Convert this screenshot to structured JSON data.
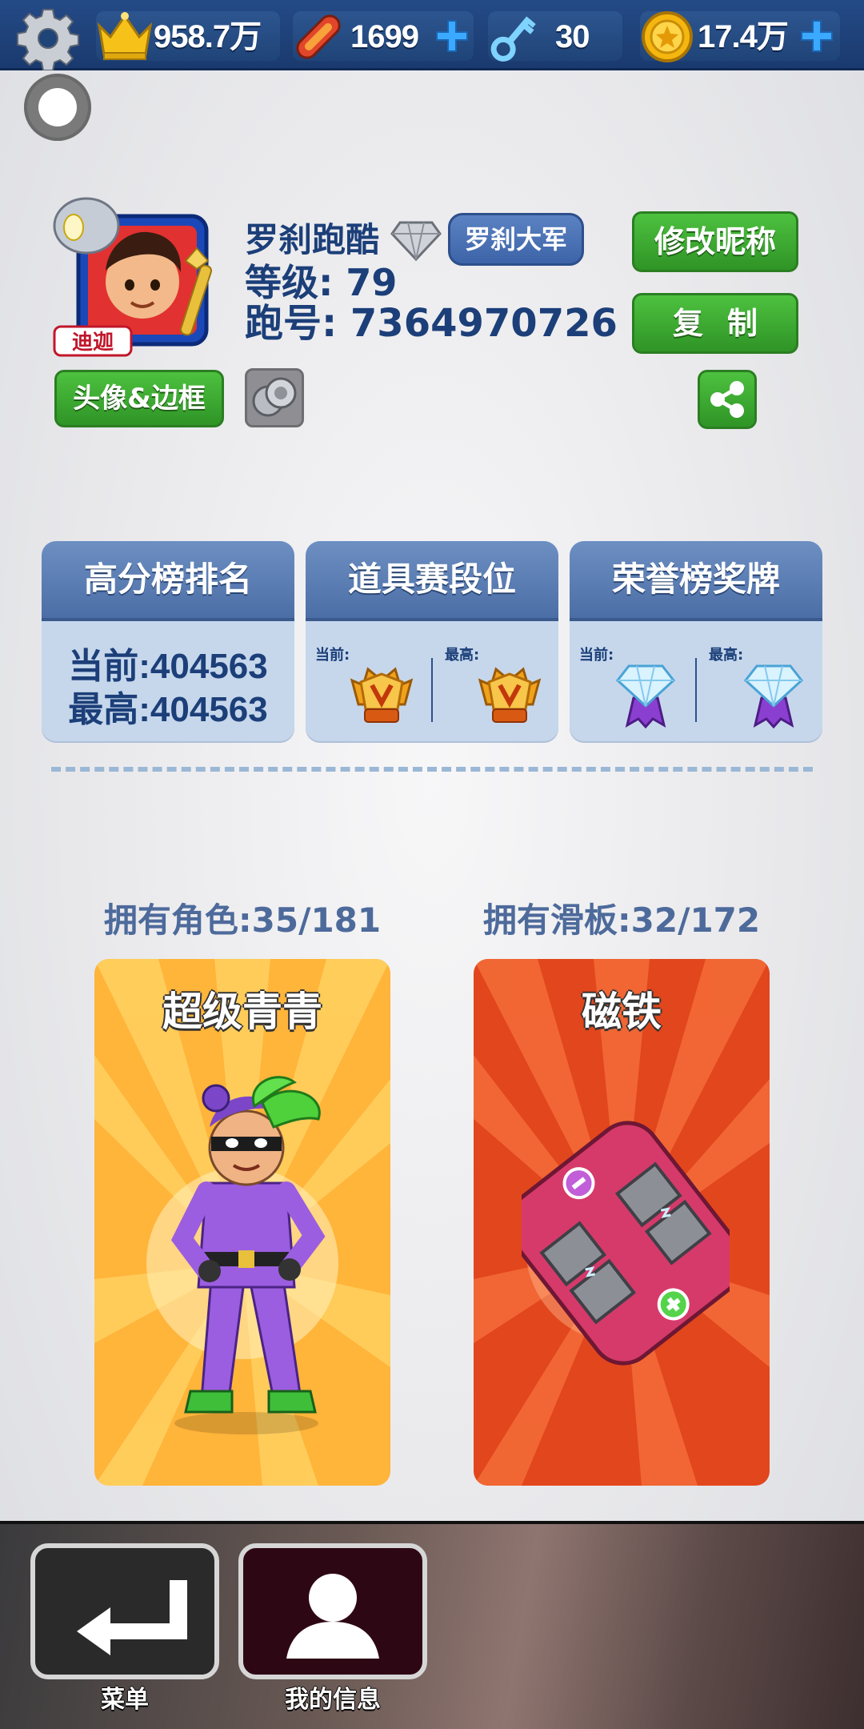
{
  "topbar": {
    "crowns": "958.7万",
    "boards": "1699",
    "keys": "30",
    "coins": "17.4万"
  },
  "profile": {
    "avatar_caption": "迪迦",
    "name": "罗刹跑酷",
    "team": "罗刹大军",
    "level": "等级: 79",
    "player_id": "跑号: 7364970726",
    "avatar_frame_button": "头像&边框",
    "rename_button": "修改昵称",
    "copy_button": "复制"
  },
  "stats": {
    "highscore": {
      "title": "高分榜排名",
      "current": "当前:404563",
      "best": "最高:404563"
    },
    "powerup_league": {
      "title": "道具赛段位",
      "current_label": "当前:",
      "best_label": "最高:"
    },
    "honor_medal": {
      "title": "荣誉榜奖牌",
      "current_label": "当前:",
      "best_label": "最高:"
    }
  },
  "collection": {
    "characters_owned": "拥有角色:35/181",
    "boards_owned": "拥有滑板:32/172",
    "character_name": "超级青青",
    "board_name": "磁铁"
  },
  "nav": {
    "menu_label": "菜单",
    "info_label": "我的信息"
  },
  "colors": {
    "topbar": "#1f4478",
    "green_button": "#3fae33",
    "card_bg": "#c6d7ec",
    "card_head": "#5a7db5",
    "text_blue": "#1c3f79",
    "character_panel": "#ffb43a",
    "board_panel": "#e2461c"
  },
  "icons": {
    "settings": "gear-icon",
    "crown": "crown-icon",
    "board": "hoverboard-icon",
    "key": "key-icon",
    "coin": "coin-icon",
    "share": "share-icon",
    "menu": "return-arrow-icon",
    "info": "person-icon"
  }
}
